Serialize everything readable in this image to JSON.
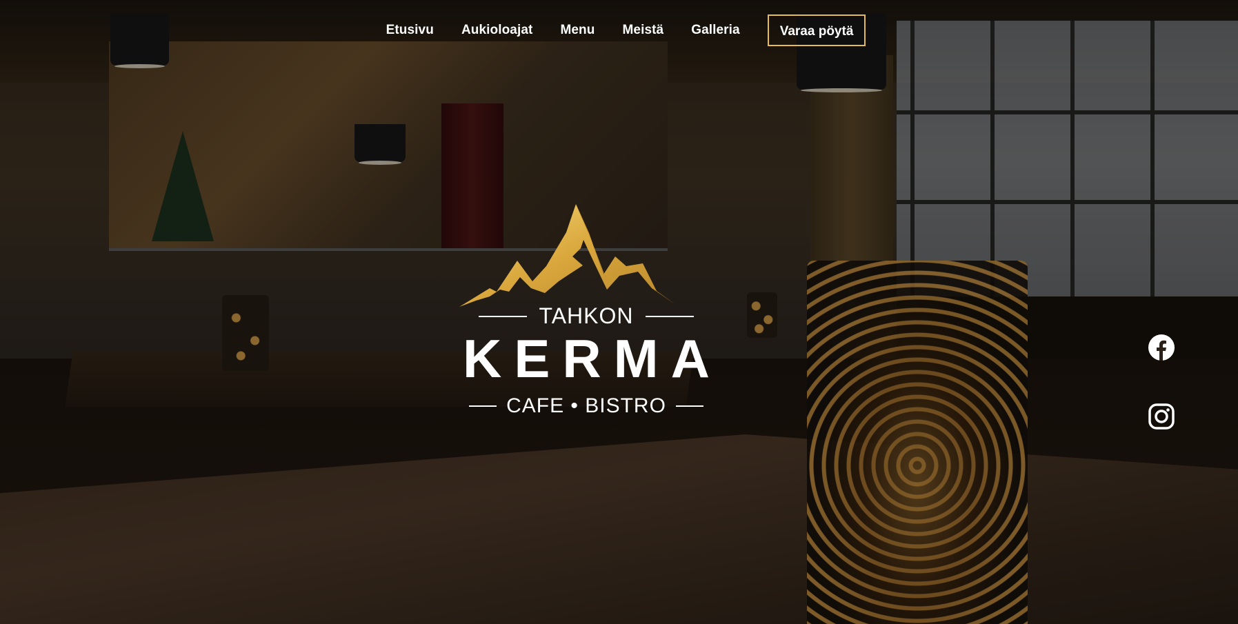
{
  "nav": {
    "items": [
      {
        "label": "Etusivu"
      },
      {
        "label": "Aukioloajat"
      },
      {
        "label": "Menu"
      },
      {
        "label": "Meistä"
      },
      {
        "label": "Galleria"
      }
    ],
    "cta_label": "Varaa pöytä"
  },
  "logo": {
    "top_text": "TAHKON",
    "main_text": "KERMA",
    "bottom_text": "CAFE • BISTRO",
    "icon": "mountain-peaks-icon"
  },
  "social": {
    "items": [
      {
        "icon": "facebook-icon"
      },
      {
        "icon": "instagram-icon"
      }
    ]
  },
  "colors": {
    "accent_gold": "#e6bc5a",
    "text": "#ffffff"
  }
}
